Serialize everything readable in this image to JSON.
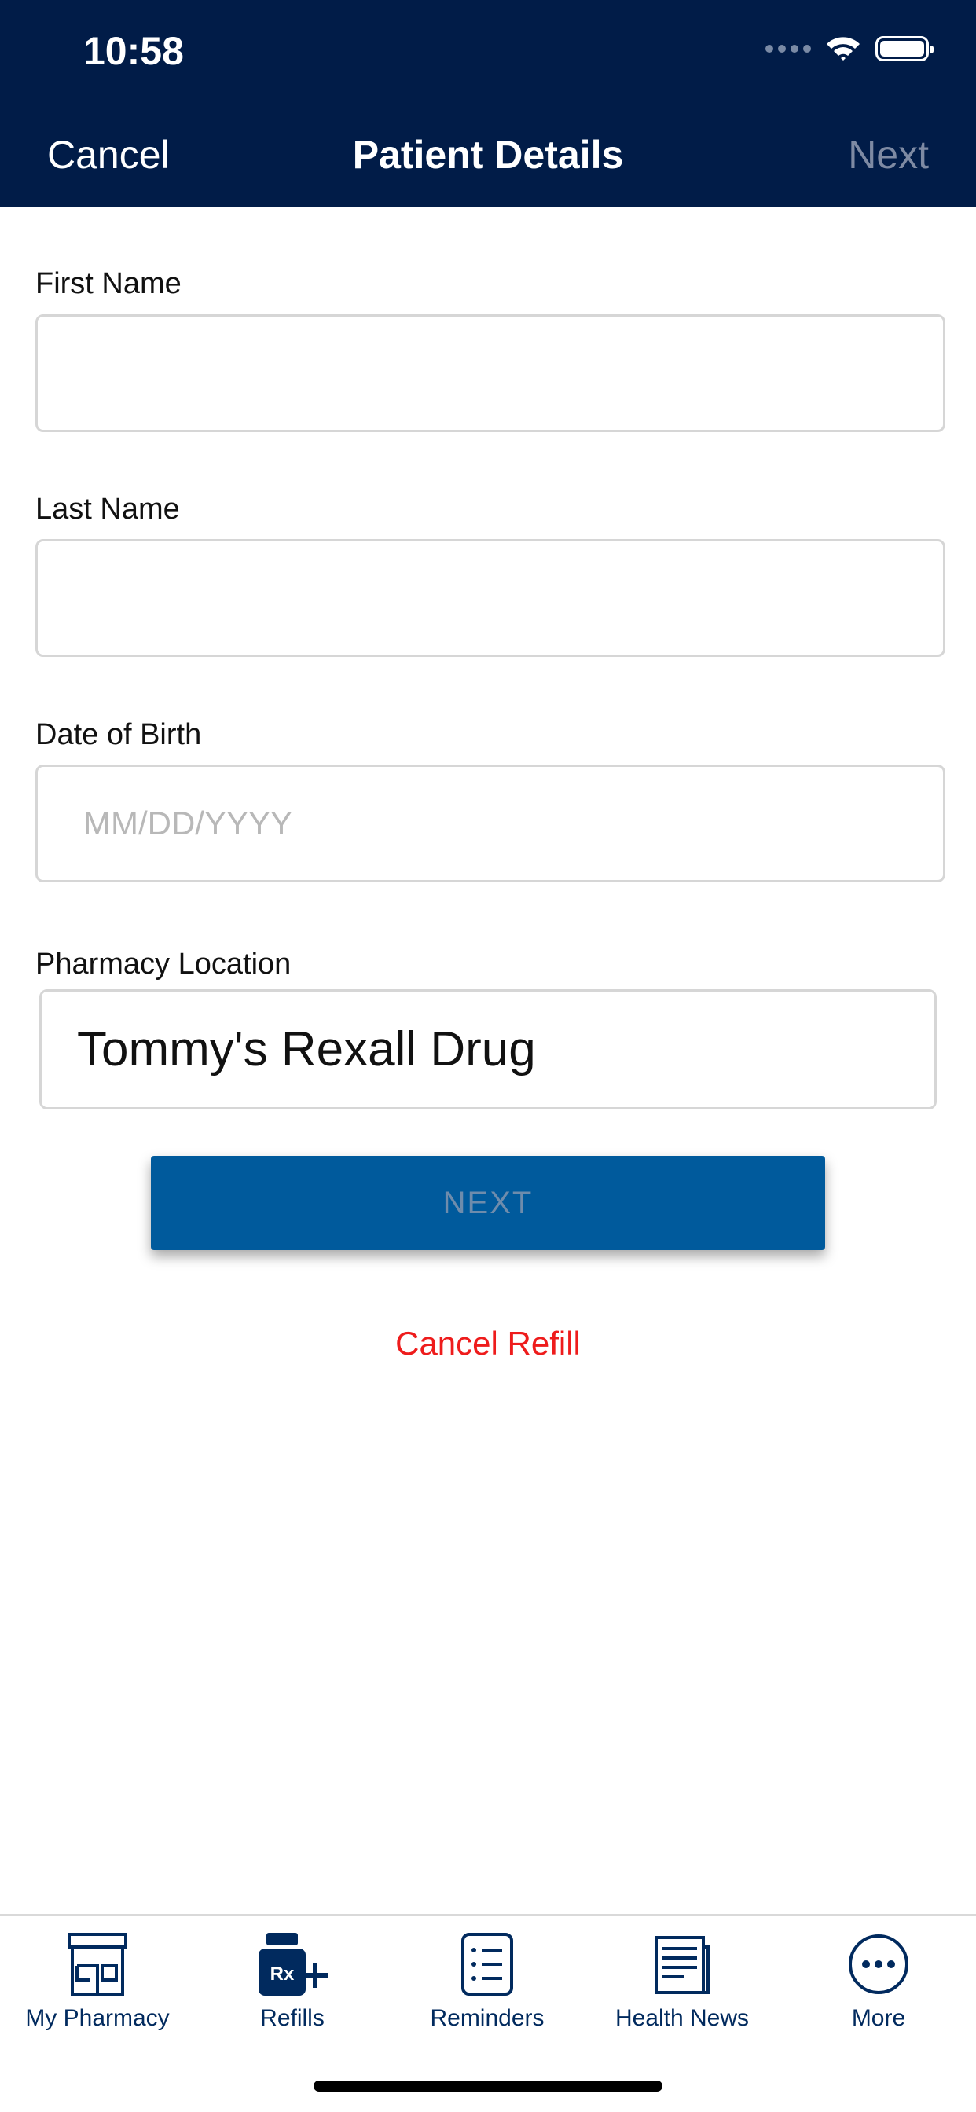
{
  "status_bar": {
    "time": "10:58"
  },
  "nav": {
    "cancel": "Cancel",
    "title": "Patient Details",
    "next": "Next"
  },
  "form": {
    "first_name": {
      "label": "First Name",
      "value": "",
      "placeholder": ""
    },
    "last_name": {
      "label": "Last Name",
      "value": "",
      "placeholder": ""
    },
    "dob": {
      "label": "Date of Birth",
      "value": "",
      "placeholder": "MM/DD/YYYY"
    },
    "pharmacy": {
      "label": "Pharmacy Location",
      "value": "Tommy's Rexall Drug"
    }
  },
  "actions": {
    "next": "NEXT",
    "cancel_refill": "Cancel Refill"
  },
  "tabs": [
    {
      "label": "My Pharmacy",
      "icon": "storefront-icon"
    },
    {
      "label": "Refills",
      "icon": "rx-plus-icon"
    },
    {
      "label": "Reminders",
      "icon": "checklist-icon"
    },
    {
      "label": "Health News",
      "icon": "newspaper-icon"
    },
    {
      "label": "More",
      "icon": "more-dots-icon"
    }
  ],
  "colors": {
    "header_bg": "#011c48",
    "primary_button": "#005a9c",
    "cancel_red": "#ee1c1c",
    "tab_icon": "#012a5e"
  }
}
